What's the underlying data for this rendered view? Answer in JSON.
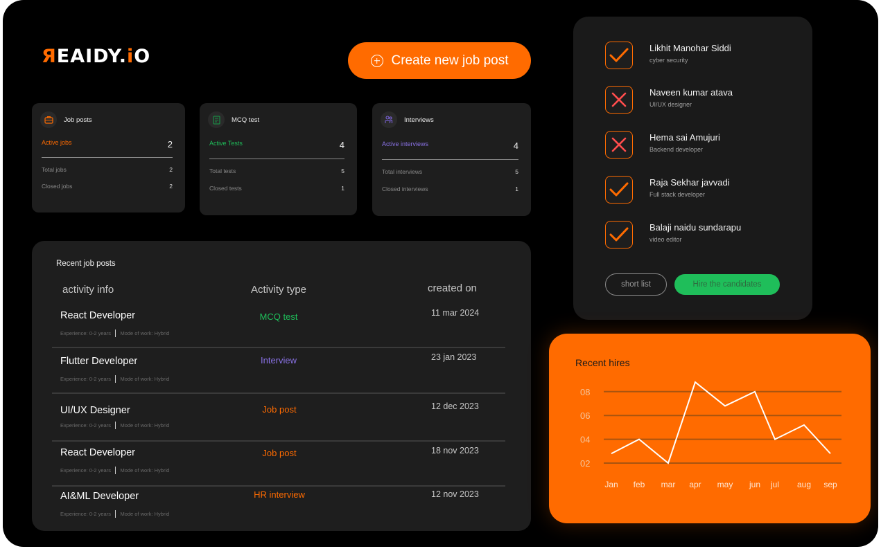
{
  "brand": {
    "logo_accent": "Я",
    "logo_rest_1": "EAIDY.",
    "logo_i": "i",
    "logo_o": "O"
  },
  "header": {
    "create_label": "Create new job post",
    "create_icon": "plus-circle-icon"
  },
  "colors": {
    "accent": "#ff6b00",
    "green": "#1fbe5a",
    "purple": "#8a72e6",
    "red": "#ff4d4d"
  },
  "stats": [
    {
      "title": "Job posts",
      "icon": "briefcase-icon",
      "active_label": "Active jobs",
      "active_value": "2",
      "active_color": "#ff6b00",
      "rows": [
        {
          "label": "Total jobs",
          "value": "2"
        },
        {
          "label": "Closed jobs",
          "value": "2"
        }
      ]
    },
    {
      "title": "MCQ test",
      "icon": "clipboard-icon",
      "active_label": "Active Tests",
      "active_value": "4",
      "active_color": "#1fbe5a",
      "rows": [
        {
          "label": "Total tests",
          "value": "5"
        },
        {
          "label": "Closed tests",
          "value": "1"
        }
      ]
    },
    {
      "title": "Interviews",
      "icon": "interview-icon",
      "active_label": "Active interviews",
      "active_value": "4",
      "active_color": "#8a72e6",
      "rows": [
        {
          "label": "Total interviews",
          "value": "5"
        },
        {
          "label": "Closed interviews",
          "value": "1"
        }
      ]
    }
  ],
  "recent": {
    "title": "Recent job posts",
    "columns": [
      "activity info",
      "Activity type",
      "created on"
    ],
    "rows": [
      {
        "name": "React Developer",
        "experience": "Experience: 0-2 years",
        "mode": "Mode of work: Hybrid",
        "type": "MCQ test",
        "type_color": "#1fbe5a",
        "date": "11 mar 2024"
      },
      {
        "name": "Flutter Developer",
        "experience": "Experience: 0-2 years",
        "mode": "Mode of work: Hybrid",
        "type": "Interview",
        "type_color": "#8a72e6",
        "date": "23 jan 2023"
      },
      {
        "name": "UI/UX Designer",
        "experience": "Experience: 0-2 years",
        "mode": "Mode of work: Hybrid",
        "type": "Job post",
        "type_color": "#ff6b00",
        "date": "12 dec 2023"
      },
      {
        "name": "React Developer",
        "experience": "Experience: 0-2 years",
        "mode": "Mode of work: Hybrid",
        "type": "Job post",
        "type_color": "#ff6b00",
        "date": "18 nov  2023"
      },
      {
        "name": "AI&ML Developer",
        "experience": "Experience: 0-2 years",
        "mode": "Mode of work: Hybrid",
        "type": "HR interview",
        "type_color": "#ff6b00",
        "date": "12 nov  2023"
      }
    ]
  },
  "candidates": {
    "items": [
      {
        "name": "Likhit Manohar Siddi",
        "role": "cyber security",
        "status": "accepted"
      },
      {
        "name": "Naveen kumar atava",
        "role": "UI/UX designer",
        "status": "rejected"
      },
      {
        "name": "Hema sai Amujuri",
        "role": "Backend developer",
        "status": "rejected"
      },
      {
        "name": "Raja Sekhar javvadi",
        "role": "Full stack developer",
        "status": "accepted"
      },
      {
        "name": "Balaji naidu sundarapu",
        "role": "video editor",
        "status": "accepted"
      }
    ],
    "shortlist_label": "short list",
    "hire_label": "Hire the candidates"
  },
  "chart_data": {
    "type": "line",
    "title": "Recent hires",
    "categories": [
      "Jan",
      "feb",
      "mar",
      "apr",
      "may",
      "jun",
      "jul",
      "aug",
      "sep"
    ],
    "values": [
      2.8,
      4,
      2,
      8.8,
      6.8,
      8,
      4,
      5.2,
      2.8
    ],
    "yticks": [
      "02",
      "04",
      "06",
      "08"
    ],
    "ytick_values": [
      2,
      4,
      6,
      8
    ],
    "ylim": [
      2,
      8
    ],
    "grid": true,
    "xlabel": "",
    "ylabel": ""
  }
}
